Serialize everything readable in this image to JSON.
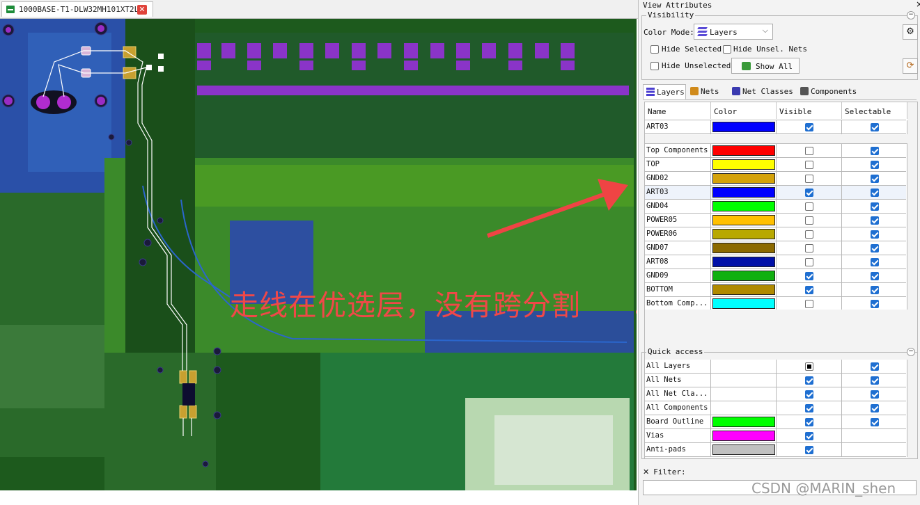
{
  "document_tab": {
    "title": "1000BASE-T1-DLW32MH101XT2L*"
  },
  "annotation": {
    "text": "走线在优选层，没有跨分割"
  },
  "panel": {
    "title": "View Attributes",
    "visibility": {
      "label": "Visibility",
      "color_mode_label": "Color Mode:",
      "color_mode_value": "Layers",
      "hide_selected": "Hide Selected",
      "hide_unsel_nets": "Hide Unsel. Nets",
      "hide_unselected": "Hide Unselected",
      "show_all": "Show All"
    },
    "tabs": [
      "Layers",
      "Nets",
      "Net Classes",
      "Components"
    ],
    "columns": [
      "Name",
      "Color",
      "Visible",
      "Selectable"
    ],
    "active_layer": {
      "name": "ART03",
      "color": "#0000ff",
      "visible": true,
      "selectable": true
    },
    "layers": [
      {
        "name": "Top Components",
        "color": "#ff0000",
        "visible": false,
        "selectable": true
      },
      {
        "name": "TOP",
        "color": "#ffff00",
        "visible": false,
        "selectable": true
      },
      {
        "name": "GND02",
        "color": "#d4a20a",
        "visible": false,
        "selectable": true
      },
      {
        "name": "ART03",
        "color": "#0000ff",
        "visible": true,
        "selectable": true
      },
      {
        "name": "GND04",
        "color": "#00ff00",
        "visible": false,
        "selectable": true
      },
      {
        "name": "POWER05",
        "color": "#ffc000",
        "visible": false,
        "selectable": true
      },
      {
        "name": "POWER06",
        "color": "#b8a800",
        "visible": false,
        "selectable": true
      },
      {
        "name": "GND07",
        "color": "#8c6a00",
        "visible": false,
        "selectable": true
      },
      {
        "name": "ART08",
        "color": "#0010a8",
        "visible": false,
        "selectable": true
      },
      {
        "name": "GND09",
        "color": "#10b010",
        "visible": true,
        "selectable": true
      },
      {
        "name": "BOTTOM",
        "color": "#b08a00",
        "visible": true,
        "selectable": true
      },
      {
        "name": "Bottom Comp...",
        "color": "#00ffff",
        "visible": false,
        "selectable": true
      }
    ],
    "quick_access": {
      "label": "Quick access",
      "rows": [
        {
          "name": "All Layers",
          "color": null,
          "visible": "partial",
          "selectable": true
        },
        {
          "name": "All Nets",
          "color": null,
          "visible": true,
          "selectable": true
        },
        {
          "name": "All Net Cla...",
          "color": null,
          "visible": true,
          "selectable": true
        },
        {
          "name": "All Components",
          "color": null,
          "visible": true,
          "selectable": true
        },
        {
          "name": "Board Outline",
          "color": "#00ff00",
          "visible": true,
          "selectable": true
        },
        {
          "name": "Vias",
          "color": "#ff00ff",
          "visible": true,
          "selectable": null
        },
        {
          "name": "Anti-pads",
          "color": "#c0c0c0",
          "visible": true,
          "selectable": null
        }
      ]
    },
    "filter_label": "Filter:",
    "filter_value": ""
  },
  "watermark": "CSDN @MARIN_shen"
}
